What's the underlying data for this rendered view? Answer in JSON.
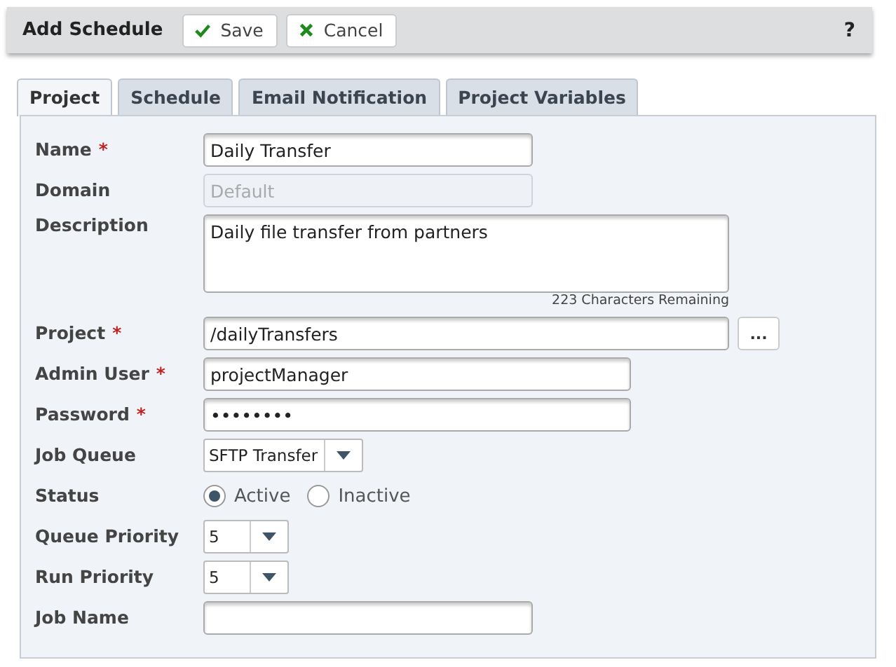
{
  "header": {
    "title": "Add Schedule",
    "buttons": [
      {
        "label": "Save",
        "kind": "save"
      },
      {
        "label": "Cancel",
        "kind": "cancel"
      }
    ],
    "help": "?"
  },
  "tabs": [
    {
      "label": "Project",
      "selected": true
    },
    {
      "label": "Schedule",
      "selected": false
    },
    {
      "label": "Email Notification",
      "selected": false
    },
    {
      "label": "Project Variables",
      "selected": false
    }
  ],
  "fields": [
    {
      "kind": "text",
      "label": "Name",
      "required_mark": "*",
      "value": "Daily Transfer"
    },
    {
      "kind": "text",
      "label": "Domain",
      "disabled": true,
      "value": "Default"
    },
    {
      "kind": "textarea",
      "label": "Description",
      "value": "Daily file transfer from partners",
      "counter": "223 Characters Remaining"
    },
    {
      "kind": "browse",
      "label": "Project",
      "required_mark": "*",
      "value": "/dailyTransfers",
      "button": "..."
    },
    {
      "kind": "medium",
      "label": "Admin User",
      "required_mark": "*",
      "value": "projectManager"
    },
    {
      "kind": "medium",
      "label": "Password",
      "required_mark": "*",
      "value": "••••••••"
    },
    {
      "kind": "select",
      "label": "Job Queue",
      "value": "SFTP Transfer"
    },
    {
      "kind": "radio",
      "label": "Status",
      "options": [
        {
          "label": "Active",
          "selected": true
        },
        {
          "label": "Inactive",
          "selected": false
        }
      ]
    },
    {
      "kind": "small-select",
      "label": "Queue Priority",
      "value": "5"
    },
    {
      "kind": "small-select",
      "label": "Run Priority",
      "value": "5"
    },
    {
      "kind": "text",
      "label": "Job Name"
    }
  ]
}
